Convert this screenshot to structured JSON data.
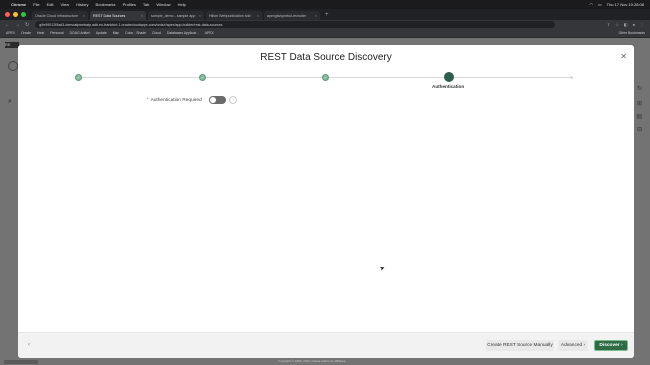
{
  "menubar": {
    "app": "Chrome",
    "items": [
      "File",
      "Edit",
      "View",
      "History",
      "Bookmarks",
      "Profiles",
      "Tab",
      "Window",
      "Help"
    ],
    "clock": "Thu 17 Nov 10:28:08"
  },
  "browser": {
    "tabs": [
      {
        "label": "Oracle Cloud Infrastructure"
      },
      {
        "label": "REST Data Sources"
      },
      {
        "label": "sample_demo - sample app"
      },
      {
        "label": "Hilton Webpublication fold"
      },
      {
        "label": "apexgis/symbol-recruiter"
      }
    ],
    "url": "g9e99012f5ad3-demoatpwebatp.adb.eu-frankfurt-1.oraclecloudapps.com/ords/r/apex/app-builder/rest-data-sources",
    "bookmarks": [
      "APEX",
      "Oracle",
      "Heat",
      "Personal",
      "DOAG Artikel",
      "Update",
      "Mac",
      "Color - Shade",
      "Cloud",
      "Databases Applicat...",
      "APEX"
    ],
    "all_bookmarks": "Other Bookmarks"
  },
  "background": {
    "sidebar_label": "RE"
  },
  "dialog": {
    "title": "REST Data Source Discovery",
    "current_step_label": "Authentication",
    "fields": {
      "auth_required_label": "Authentication Required",
      "required_marker": "*",
      "help_icon": "?"
    },
    "footer": {
      "create_manually": "Create REST Source Manually",
      "advanced": "Advanced ›",
      "discover": "Discover ›"
    }
  },
  "status": {
    "copyright": "Copyright © 1999, 2022, Oracle and/or its affiliates."
  },
  "colors": {
    "step_done": "#7fb79b",
    "step_current": "#2f5d4e",
    "discover_button": "#2f6b45"
  }
}
